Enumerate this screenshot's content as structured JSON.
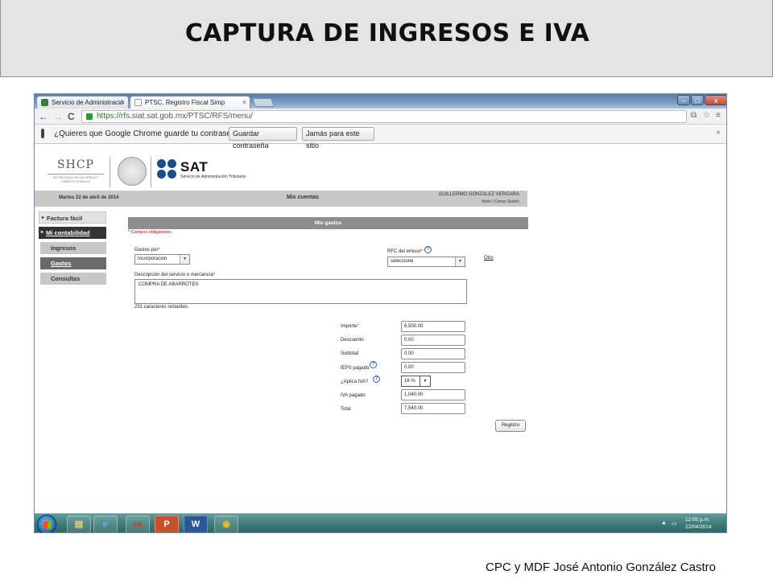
{
  "slide": {
    "title": "CAPTURA DE INGRESOS E IVA",
    "credit": "CPC y MDF José Antonio González Castro"
  },
  "browser": {
    "tabs": [
      {
        "label": "Servicio de Administració",
        "close": "×"
      },
      {
        "label": "PTSC. Registro Fiscal Simp",
        "close": "×"
      }
    ],
    "window_controls": {
      "min": "–",
      "max": "□",
      "close": "x"
    },
    "nav": {
      "back": "←",
      "forward": "→",
      "reload": "C"
    },
    "url_scheme": "https://",
    "url_host": "rfs.siat.sat.gob.mx",
    "url_path": "/PTSC/RFS/menu/",
    "extension_icons": [
      "⧉",
      "☆"
    ],
    "menu_icon": "≡",
    "password_prompt": {
      "message": "¿Quieres que Google Chrome guarde tu contraseña?",
      "save_label": "Guardar contraseña",
      "never_label": "Jamás para este sitio",
      "close": "×"
    }
  },
  "sat_header": {
    "shcp": "SHCP",
    "shcp_sub": "SECRETARÍA DE HACIENDA Y CRÉDITO PÚBLICO",
    "sat": "SAT",
    "sat_sub": "Servicio de Administración Tributaria",
    "date": "Martes 22 de abril de 2014",
    "section": "Mis cuentas",
    "user": "GUILLERMO GONZALEZ VERGARA",
    "user_links": "Inicio | Cerrar Sesión"
  },
  "menu": {
    "factura": "Factura fácil",
    "mi_contabilidad": "Mi contabilidad",
    "ingresos": "Ingresos",
    "gastos": "Gastos",
    "consultas": "Consultas"
  },
  "form": {
    "title": "Mis gastos",
    "required_note": "* Campos obligatorios",
    "gastos_por_label": "Gastos por",
    "gastos_por_value": "Incorporacion",
    "rfc_label": "RFC del emisor",
    "rfc_value": "seleccione",
    "otro": "Otro",
    "descripcion_label": "Descripción del servicio o mercancía",
    "descripcion_value": "COMPRA DE ABARROTES",
    "remaining": "231 caracteres restantes.",
    "importe_label": "Importe",
    "importe": "6,500.00",
    "descuento_label": "Descuento",
    "descuento": "0.00",
    "subtotal_label": "Subtotal",
    "subtotal": "0.00",
    "ieps_label": "IEPS pagado",
    "ieps": "0.00",
    "aplica_iva_label": "¿Aplica IVA?",
    "aplica_iva": "16 %",
    "iva_pagado_label": "IVA pagado",
    "iva_pagado": "1,040.00",
    "total_label": "Total",
    "total": "7,540.00",
    "submit": "Registro"
  },
  "taskbar": {
    "apps": [
      "explorer",
      "ie",
      "sa",
      "powerpoint",
      "word",
      "chrome"
    ],
    "app_glyphs": [
      "▤",
      "e",
      "SA",
      "P",
      "W",
      "◉"
    ],
    "time": "12:00 p.m.",
    "date": "22/04/2014"
  },
  "colors": {
    "slide_header_bg": "#e4e4e4",
    "menu_active": "#333333",
    "form_header": "#8d8d8d",
    "required": "#cc0000",
    "taskbar": "#3d7877"
  }
}
